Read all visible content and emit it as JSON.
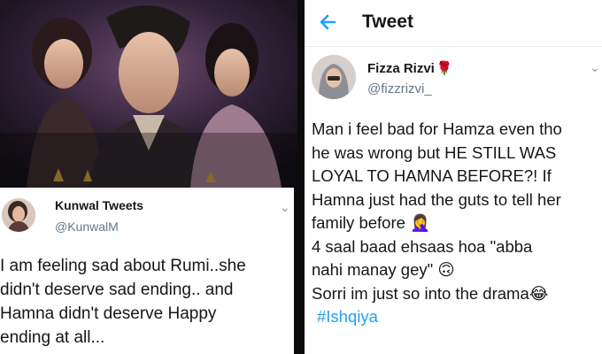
{
  "left_tweet": {
    "display_name": "Kunwal Tweets",
    "handle": "@KunwalM",
    "lines": [
      "I am feeling sad about Rumi..she",
      "didn't deserve sad ending.. and",
      "Hamna didn't deserve Happy",
      "ending at all..."
    ]
  },
  "right_header": {
    "title": "Tweet"
  },
  "right_tweet": {
    "display_name": "Fizza Rizvi",
    "name_emoji": "🌹",
    "handle": "@fizzrizvi_",
    "lines": [
      "Man i feel bad for Hamza even tho",
      "he was wrong but HE STILL WAS",
      "LOYAL TO HAMNA BEFORE?! If",
      "Hamna just had the guts to tell her",
      "family before 🤦‍♀️",
      "4 saal baad ehsaas hoa \"abba",
      "nahi manay gey\" 🙃",
      "Sorri im just so into the drama😂"
    ],
    "hashtag": "#Ishqiya"
  },
  "colors": {
    "accent": "#1da1f2",
    "text": "#14171a",
    "muted": "#657786"
  },
  "icons": {
    "back": "arrow-left-icon",
    "more": "chevron-down-icon"
  }
}
